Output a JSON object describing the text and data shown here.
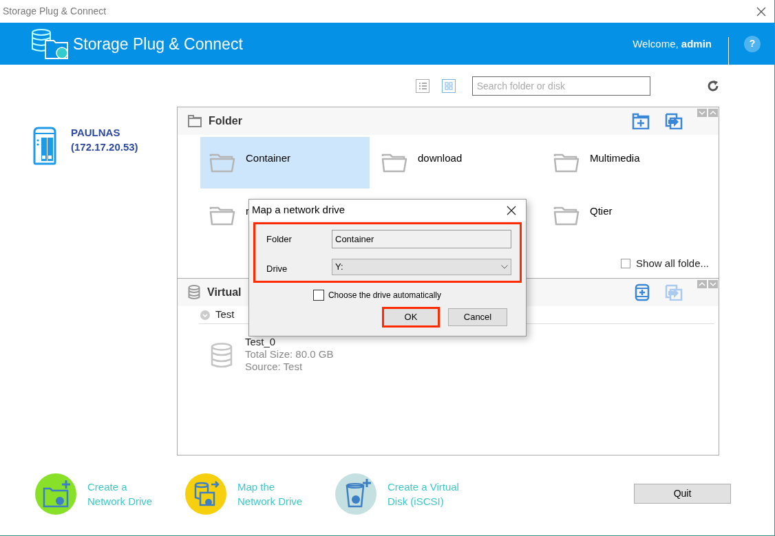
{
  "window": {
    "title": "Storage Plug & Connect"
  },
  "header": {
    "app_name": "Storage Plug & Connect",
    "welcome": "Welcome, **admin**",
    "help": "?"
  },
  "toolbar": {
    "view_modes": [
      {
        "kind": "list",
        "selected": false
      },
      {
        "kind": "grid",
        "selected": true
      }
    ],
    "search": {
      "placeholder": "Search folder or disk"
    }
  },
  "device": {
    "name": "PAULNAS",
    "address": "(172.17.20.53)"
  },
  "folder_section": {
    "title": "Folder",
    "columns": [
      [
        {
          "name": "Container",
          "selected": true
        },
        {
          "name": "r",
          "selected": false
        }
      ],
      [
        {
          "name": "download",
          "selected": false
        }
      ],
      [
        {
          "name": "Multimedia",
          "selected": false
        },
        {
          "name": "Qtier",
          "selected": false
        }
      ]
    ],
    "show_all": {
      "label": "Show all folde...",
      "checked": false
    }
  },
  "virtual_section": {
    "title": "Virtual",
    "groups": [
      {
        "name": "Test",
        "expanded": true,
        "disks": [
          {
            "name": "Test_0",
            "size": "Total Size: 80.0 GB",
            "source": "Source: Test"
          }
        ]
      }
    ]
  },
  "actions": [
    {
      "kind": "create",
      "label": "Create a Network Drive"
    },
    {
      "kind": "map",
      "label": "Map the Network Drive"
    },
    {
      "kind": "iscsi",
      "label": "Create a Virtual Disk (iSCSI)"
    }
  ],
  "quit": "Quit",
  "dialog": {
    "title": "Map a network drive",
    "folder_label": "Folder",
    "folder_value": "Container",
    "drive_label": "Drive",
    "drive_value": "Y:",
    "auto": {
      "label": "Choose the drive automatically",
      "checked": false
    },
    "ok": "OK",
    "cancel": "Cancel"
  }
}
